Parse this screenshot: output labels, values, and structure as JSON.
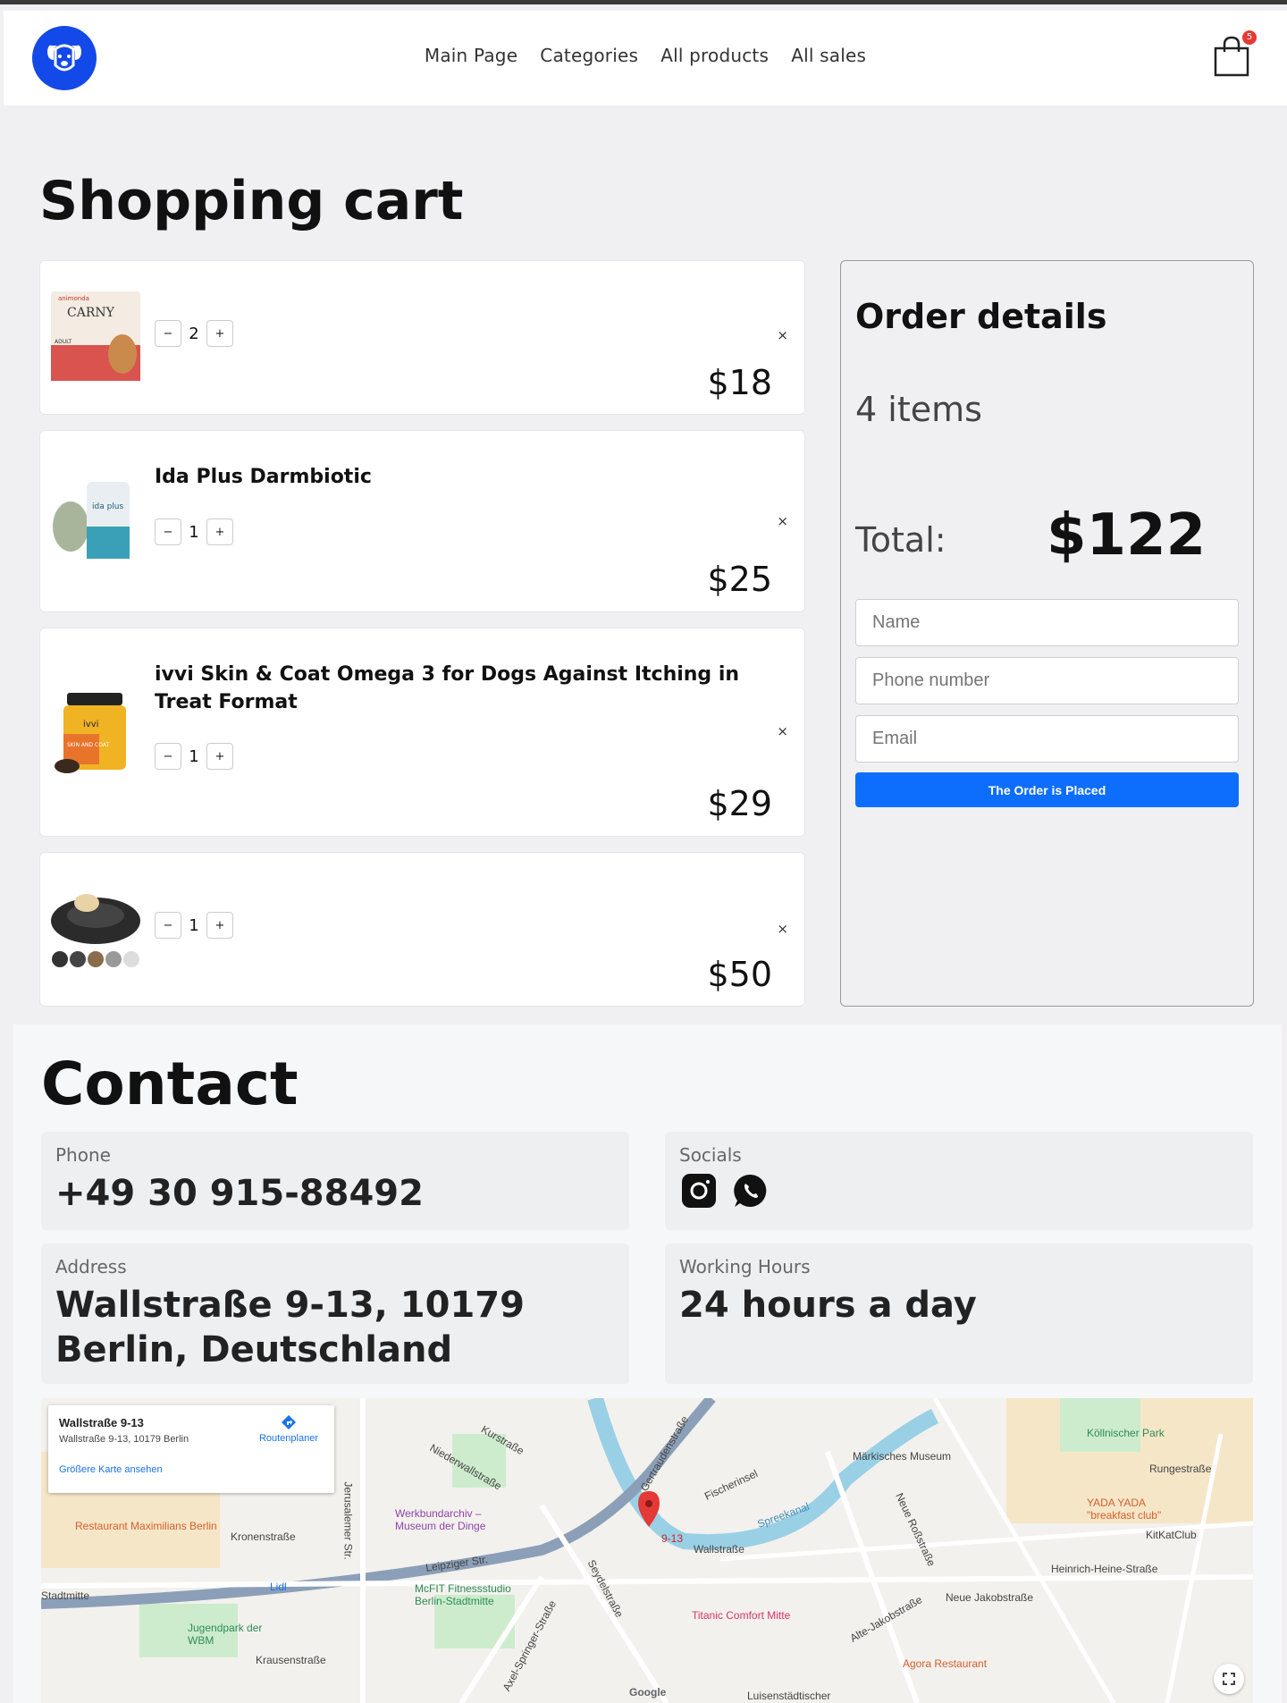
{
  "header": {
    "nav": [
      "Main Page",
      "Categories",
      "All products",
      "All sales"
    ],
    "cart_count": "5"
  },
  "cart": {
    "title": "Shopping cart",
    "items": [
      {
        "name": "",
        "quantity": "2",
        "price": "$18"
      },
      {
        "name": "Ida Plus Darmbiotic",
        "quantity": "1",
        "price": "$25"
      },
      {
        "name": "ivvi Skin & Coat Omega 3 for Dogs Against Itching in Treat Format",
        "quantity": "1",
        "price": "$29"
      },
      {
        "name": "",
        "quantity": "1",
        "price": "$50"
      }
    ],
    "minus": "−",
    "plus": "+",
    "remove": "×",
    "thumb1_brand": "animonda",
    "thumb1_name": "CARNY",
    "thumb1_label": "ADULT",
    "thumb2_name": "ida plus",
    "thumb3_name": "ivvi",
    "thumb3_label": "SKIN AND COAT"
  },
  "order": {
    "title": "Order details",
    "count": "4 items",
    "total_label": "Total:",
    "total": "$122",
    "name_placeholder": "Name",
    "phone_placeholder": "Phone number",
    "email_placeholder": "Email",
    "submit": "The Order is Placed"
  },
  "contact": {
    "title": "Contact",
    "phone_label": "Phone",
    "phone": "+49 30 915-88492",
    "socials_label": "Socials",
    "address_label": "Address",
    "address": "Wallstraße 9-13, 10179 Berlin, Deutschland",
    "hours_label": "Working Hours",
    "hours": "24 hours a day"
  },
  "map": {
    "card_title": "Wallstraße 9-13",
    "card_address": "Wallstraße 9-13, 10179 Berlin",
    "card_link": "Größere Karte ansehen",
    "route": "Routenplaner",
    "labels": {
      "kurstrasse": "Kurstraße",
      "niederwall": "Niederwallstraße",
      "gertrauden": "Gertraudenstraße",
      "fischerinsel": "Fischerinsel",
      "maerkisches": "Märkisches Museum",
      "koellnischer": "Köllnischer Park",
      "rungestrasse": "Rungestraße",
      "yada": "YADA YADA \"breakfast club\"",
      "kitkat": "KitKatClub",
      "restaurant": "Restaurant Maximilians Berlin",
      "kronenstrasse": "Kronenstraße",
      "werkbund": "Werkbundarchiv – Museum der Dinge",
      "leipziger": "Leipziger Str.",
      "mcfit": "McFIT Fitnessstudio Berlin-Stadtmitte",
      "lidl": "Lidl",
      "pin": "9-13",
      "wallstrasse": "Wallstraße",
      "spreekanal": "Spreekanal",
      "neue_ross": "Neue Roßstraße",
      "heinrich": "Heinrich-Heine-Straße",
      "titanic": "Titanic Comfort Mitte",
      "neue_jakob": "Neue Jakobstraße",
      "alte_jakob": "Alte-Jakobstraße",
      "agora": "Agora Restaurant",
      "jugendpark": "Jugendpark der WBM",
      "krausen": "Krausenstraße",
      "axel": "Axel-Springer-Straße",
      "seydel": "Seydelstraße",
      "stadtmitte": "Stadtmitte",
      "jerusalemer": "Jerusalemer Str.",
      "google": "Google",
      "luisen": "Luisenstädtischer"
    }
  }
}
